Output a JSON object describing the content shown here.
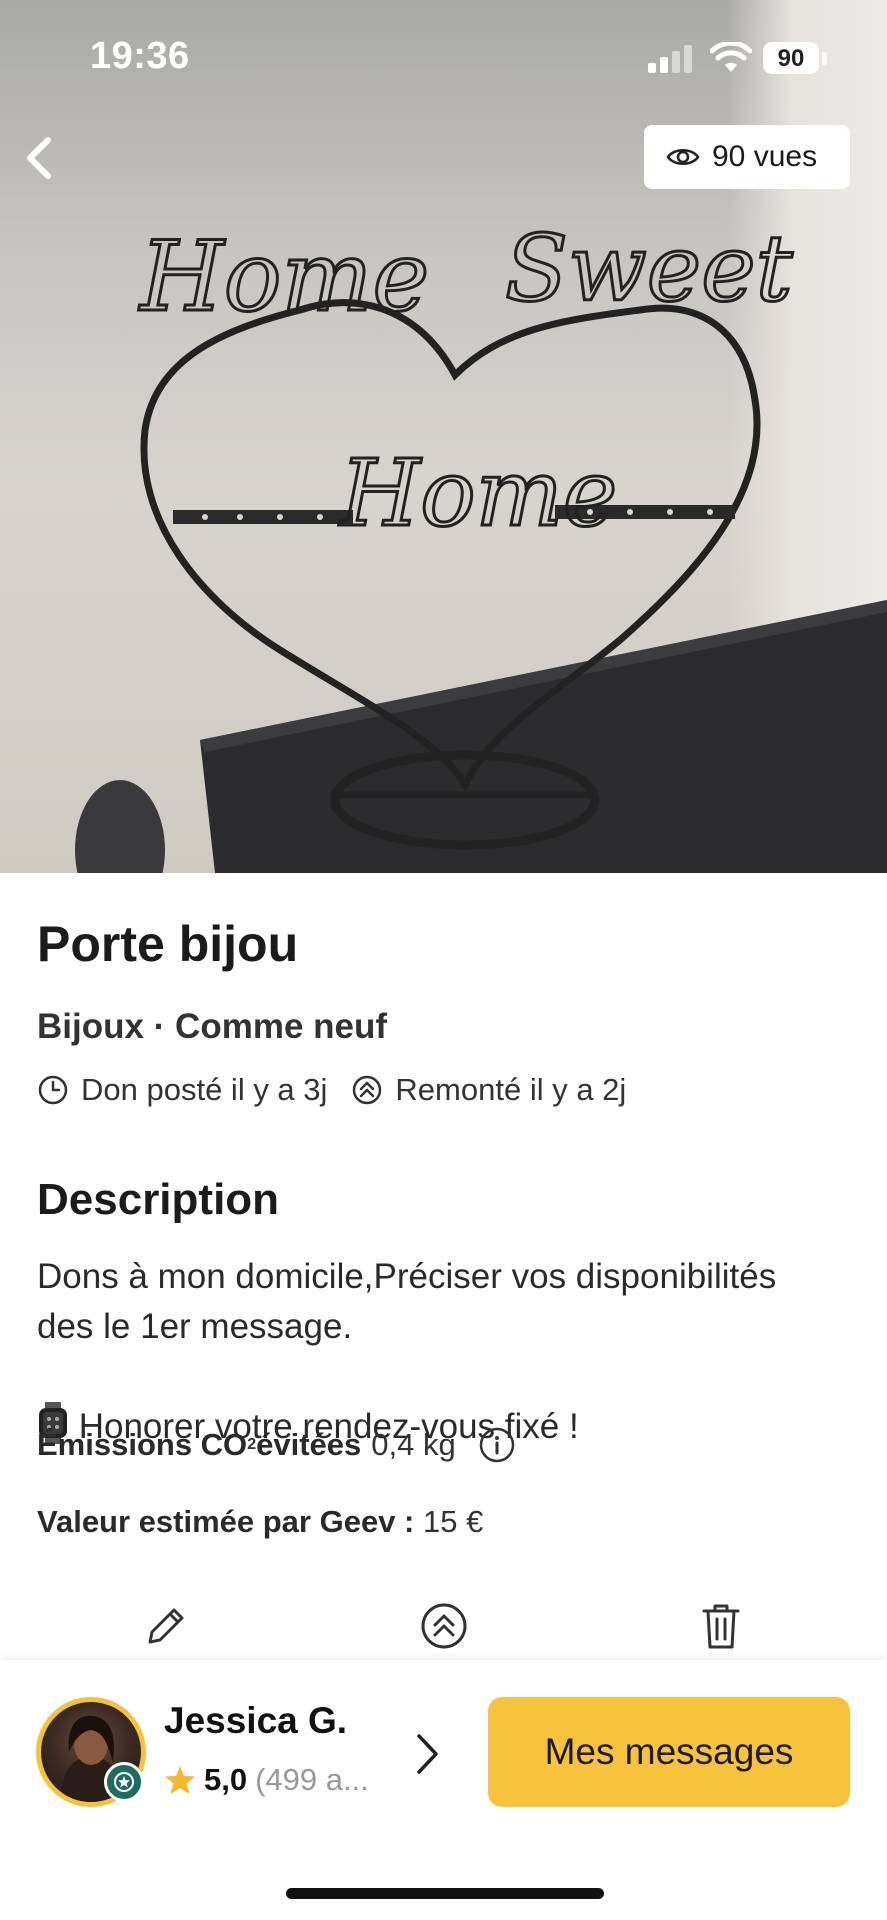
{
  "status_bar": {
    "time": "19:36",
    "battery": "90"
  },
  "hero": {
    "views_label": "90 vues",
    "image_text": "Home Sweet Home"
  },
  "listing": {
    "title": "Porte bijou",
    "subtitle": "Bijoux · Comme neuf",
    "posted": "Don posté il y a 3j",
    "bumped": "Remonté il y a 2j"
  },
  "description": {
    "heading": "Description",
    "line1": " Dons à mon domicile,Préciser vos disponibilités des le 1er message.",
    "line2": " Honorer votre rendez-vous fixé !"
  },
  "co2": {
    "label": "Émissions CO",
    "sub": "2",
    "label_end": " évitées",
    "value": "0,4 kg"
  },
  "valeur": {
    "label": "Valeur estimée par Geev :",
    "value": "15 €"
  },
  "actions": [
    "edit-icon",
    "bump-icon",
    "trash-icon"
  ],
  "user": {
    "name": "Jessica G.",
    "rating": "5,0",
    "count": "(499 a..."
  },
  "cta": {
    "label": "Mes messages"
  },
  "colors": {
    "accent": "#f7c23c",
    "badge": "#1f6b5c"
  }
}
